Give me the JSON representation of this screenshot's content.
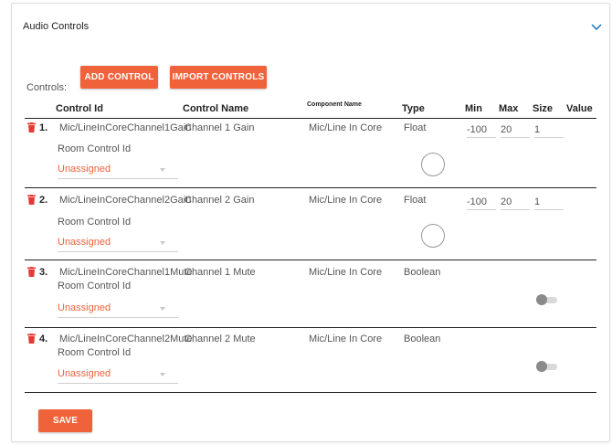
{
  "panel": {
    "title": "Audio Controls"
  },
  "toolbar": {
    "controls_label": "Controls:",
    "add_label": "ADD CONTROL",
    "import_label": "IMPORT CONTROLS"
  },
  "headers": {
    "control_id": "Control Id",
    "control_name": "Control Name",
    "component_name": "Component Name",
    "type": "Type",
    "min": "Min",
    "max": "Max",
    "size": "Size",
    "value": "Value"
  },
  "rows": [
    {
      "num": "1.",
      "control_id": "Mic/LineInCoreChannel1Gain",
      "control_name": "Channel 1 Gain",
      "component": "Mic/Line In Core",
      "type": "Float",
      "min": "-100",
      "max": "20",
      "size": "1",
      "room_label": "Room Control Id",
      "room_value": "Unassigned"
    },
    {
      "num": "2.",
      "control_id": "Mic/LineInCoreChannel2Gain",
      "control_name": "Channel 2 Gain",
      "component": "Mic/Line In Core",
      "type": "Float",
      "min": "-100",
      "max": "20",
      "size": "1",
      "room_label": "Room Control Id",
      "room_value": "Unassigned"
    },
    {
      "num": "3.",
      "control_id": "Mic/LineInCoreChannel1Mute",
      "control_name": "Channel 1 Mute",
      "component": "Mic/Line In Core",
      "type": "Boolean",
      "room_label": "Room Control Id",
      "room_value": "Unassigned"
    },
    {
      "num": "4.",
      "control_id": "Mic/LineInCoreChannel2Mute",
      "control_name": "Channel 2 Mute",
      "component": "Mic/Line In Core",
      "type": "Boolean",
      "room_label": "Room Control Id",
      "room_value": "Unassigned"
    }
  ],
  "footer": {
    "save_label": "SAVE"
  },
  "colors": {
    "accent": "#f0623a",
    "trash": "#e53935"
  },
  "icons": {
    "expand": "chevron-down-icon",
    "delete": "trash-icon"
  }
}
